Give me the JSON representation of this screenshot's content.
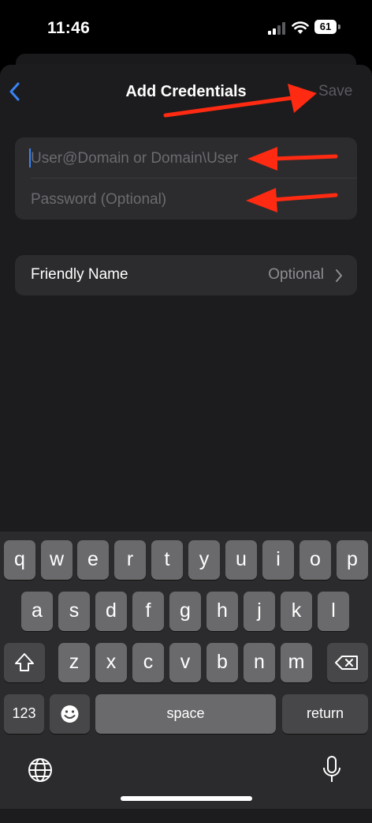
{
  "status": {
    "time": "11:46",
    "battery": "61"
  },
  "nav": {
    "title": "Add Credentials",
    "save_label": "Save"
  },
  "credentials": {
    "username_placeholder": "User@Domain or Domain\\User",
    "password_placeholder": "Password (Optional)"
  },
  "friendly_name": {
    "label": "Friendly Name",
    "value": "Optional"
  },
  "keyboard": {
    "row1": [
      "q",
      "w",
      "e",
      "r",
      "t",
      "y",
      "u",
      "i",
      "o",
      "p"
    ],
    "row2": [
      "a",
      "s",
      "d",
      "f",
      "g",
      "h",
      "j",
      "k",
      "l"
    ],
    "row3": [
      "z",
      "x",
      "c",
      "v",
      "b",
      "n",
      "m"
    ],
    "numbers_label": "123",
    "space_label": "space",
    "return_label": "return"
  },
  "colors": {
    "accent": "#3a83f5",
    "annotation_arrow": "#ff2a12"
  }
}
